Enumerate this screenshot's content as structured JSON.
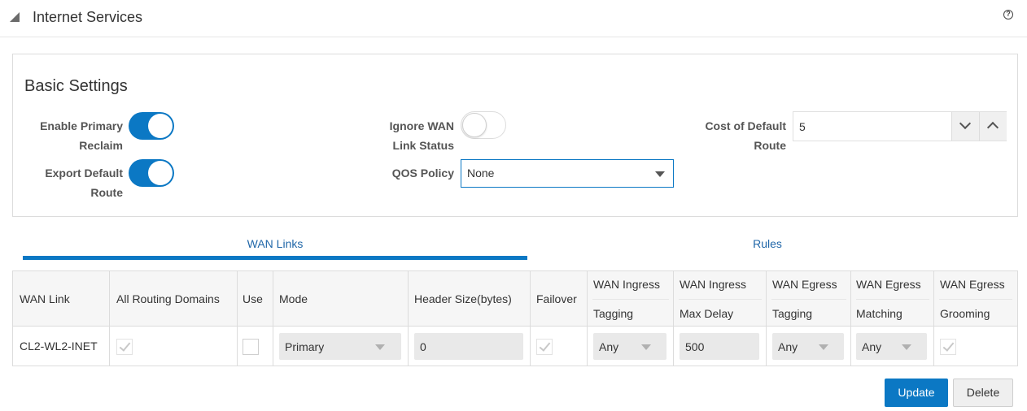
{
  "header": {
    "title": "Internet Services",
    "help": "?"
  },
  "basic_settings": {
    "title": "Basic Settings",
    "enable_primary_reclaim": {
      "label_line1": "Enable Primary",
      "label_line2": "Reclaim",
      "value": true
    },
    "export_default_route": {
      "label_line1": "Export Default",
      "label_line2": "Route",
      "value": true
    },
    "ignore_wan_link_status": {
      "label_line1": "Ignore WAN",
      "label_line2": "Link Status",
      "value": false
    },
    "qos_policy": {
      "label": "QOS Policy",
      "value": "None"
    },
    "cost_of_default_route": {
      "label_line1": "Cost of Default",
      "label_line2": "Route",
      "value": "5"
    }
  },
  "tabs": [
    {
      "label": "WAN Links",
      "selected": true
    },
    {
      "label": "Rules",
      "selected": false
    }
  ],
  "table": {
    "headers": {
      "wan_link": "WAN Link",
      "all_routing_domains": "All Routing Domains",
      "use": "Use",
      "mode": "Mode",
      "header_size": "Header Size(bytes)",
      "failover": "Failover",
      "ingress_tagging_1": "WAN Ingress",
      "ingress_tagging_2": "Tagging",
      "ingress_delay_1": "WAN Ingress",
      "ingress_delay_2": "Max Delay",
      "egress_tagging_1": "WAN Egress",
      "egress_tagging_2": "Tagging",
      "egress_matching_1": "WAN Egress",
      "egress_matching_2": "Matching",
      "egress_grooming_1": "WAN Egress",
      "egress_grooming_2": "Grooming"
    },
    "rows": [
      {
        "wan_link": "CL2-WL2-INET",
        "all_routing_domains": true,
        "use": false,
        "mode": "Primary",
        "header_size": "0",
        "failover": true,
        "ingress_tagging": "Any",
        "ingress_max_delay": "500",
        "egress_tagging": "Any",
        "egress_matching": "Any",
        "egress_grooming": true
      }
    ]
  },
  "actions": {
    "update": "Update",
    "delete": "Delete"
  },
  "colors": {
    "accent": "#0b78c4",
    "tab_text": "#1f66a8"
  }
}
